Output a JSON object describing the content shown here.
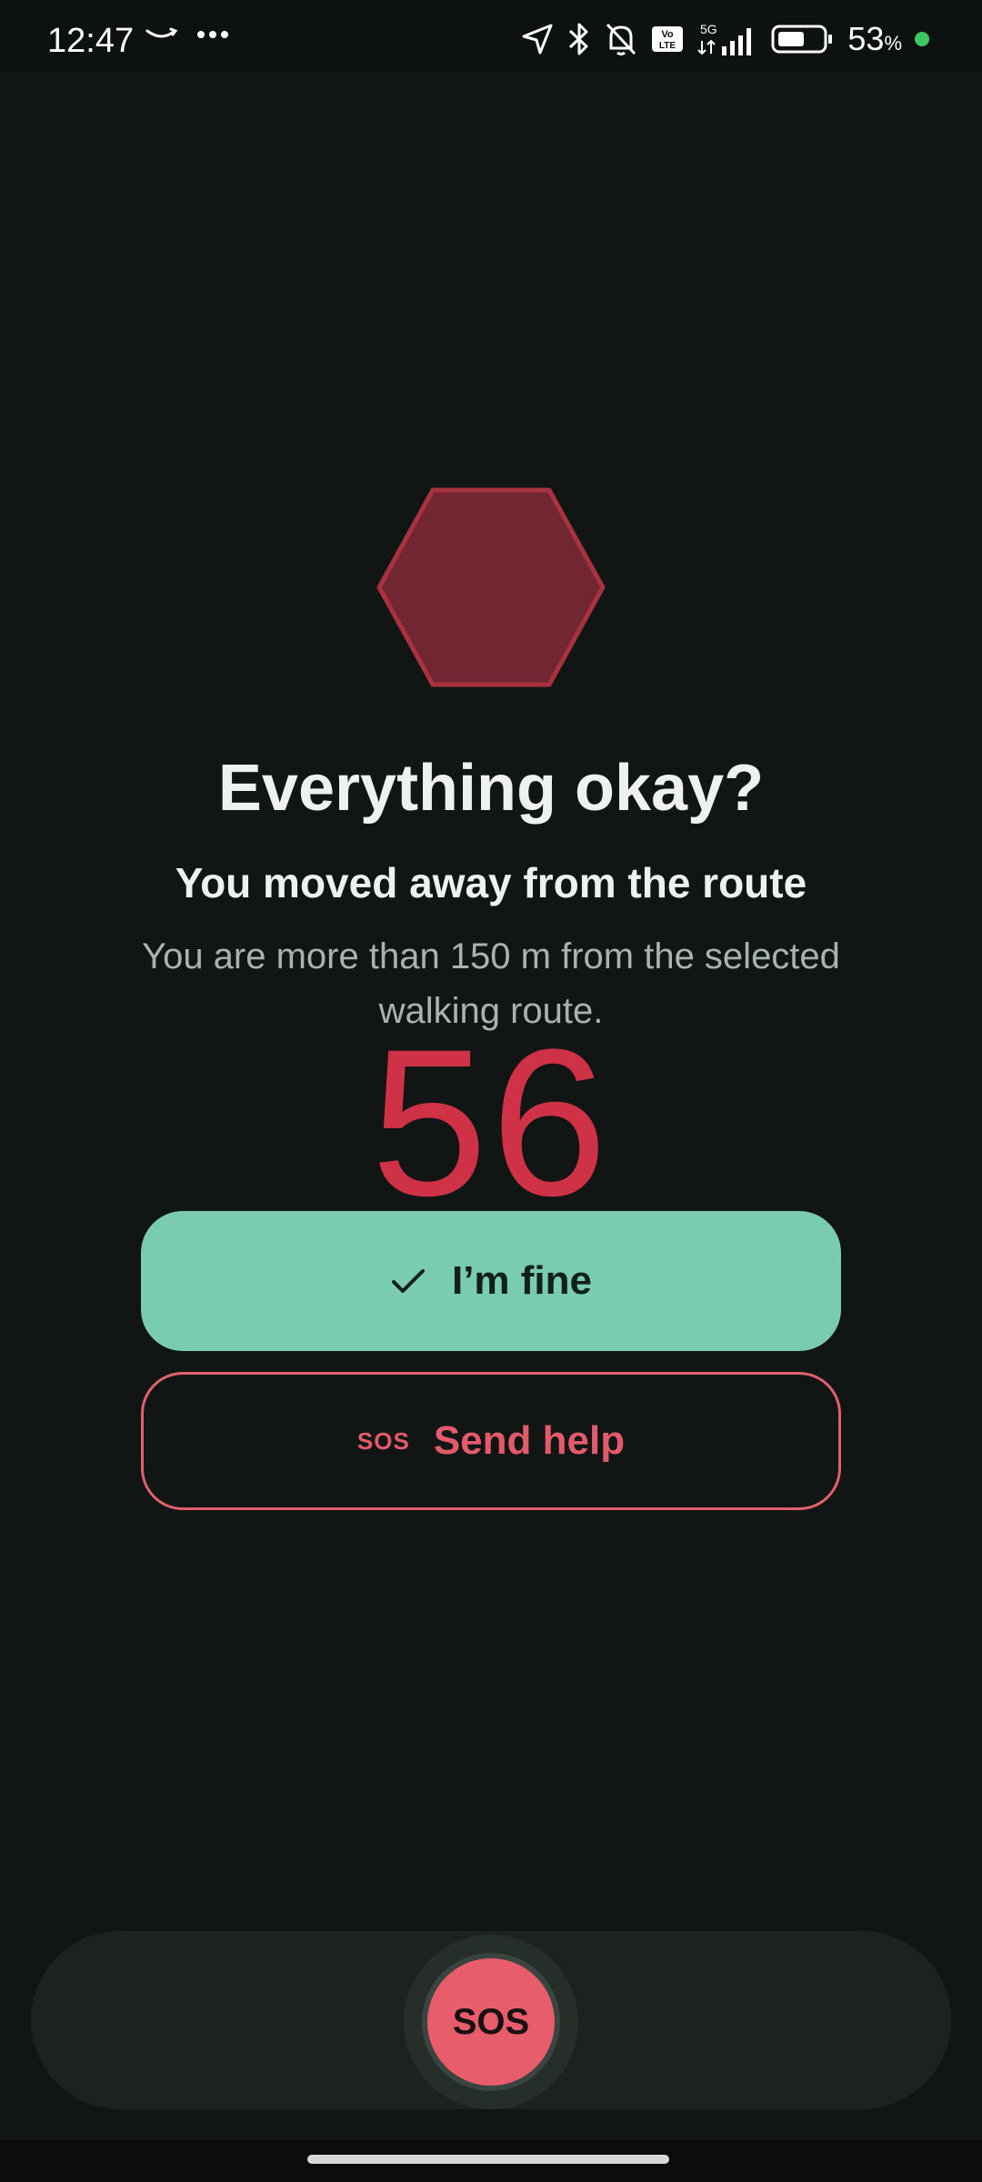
{
  "status_bar": {
    "time": "12:47",
    "battery_percent": "53",
    "battery_unit": "%",
    "network": "5G",
    "volte": "Vo LTE"
  },
  "alert": {
    "icon": "hexagon-icon",
    "title": "Everything okay?",
    "subtitle": "You moved away from the route",
    "description": "You are more than 150 m from the selected walking route.",
    "countdown": "56"
  },
  "actions": {
    "fine_label": "I’m fine",
    "fine_icon": "check-icon",
    "help_label": "Send help",
    "help_icon_text": "SOS"
  },
  "bottom_bar": {
    "sos_label": "SOS"
  },
  "colors": {
    "background": "#111614",
    "accent_green": "#79ccae",
    "accent_red": "#e35a6a",
    "countdown_red": "#cf3147",
    "hexagon_fill": "#722631",
    "hexagon_stroke": "#a8323f"
  }
}
